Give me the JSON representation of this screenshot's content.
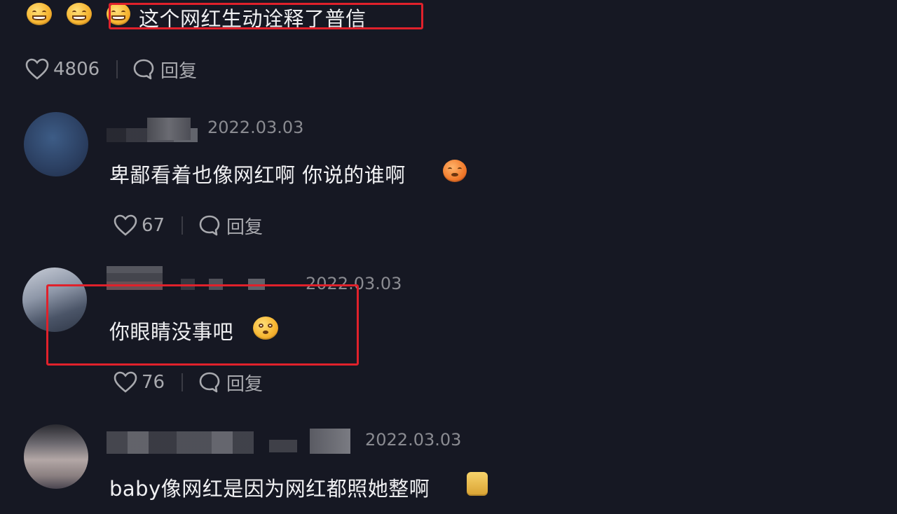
{
  "comments": [
    {
      "text": "这个网红生动诠释了普信",
      "likes": "4806",
      "reply_label": "回复",
      "emoji_before": [
        "grinning-sweat-emoji",
        "grinning-sweat-emoji",
        "grinning-sweat-emoji"
      ]
    },
    {
      "date": "2022.03.03",
      "text": "卑鄙看着也像网红啊 你说的谁啊",
      "emoji_after": "angry-emoji",
      "likes": "67",
      "reply_label": "回复"
    },
    {
      "date": "2022.03.03",
      "text": "你眼睛没事吧",
      "emoji_after": "worried-emoji",
      "likes": "76",
      "reply_label": "回复"
    },
    {
      "date": "2022.03.03",
      "text": "baby像网红是因为网红都照她整啊",
      "emoji_after": "sticker-emoji"
    }
  ],
  "colors": {
    "background": "#161823",
    "highlight_box": "#e0212b",
    "text": "#f0f0f2",
    "muted": "#8a8b91"
  }
}
